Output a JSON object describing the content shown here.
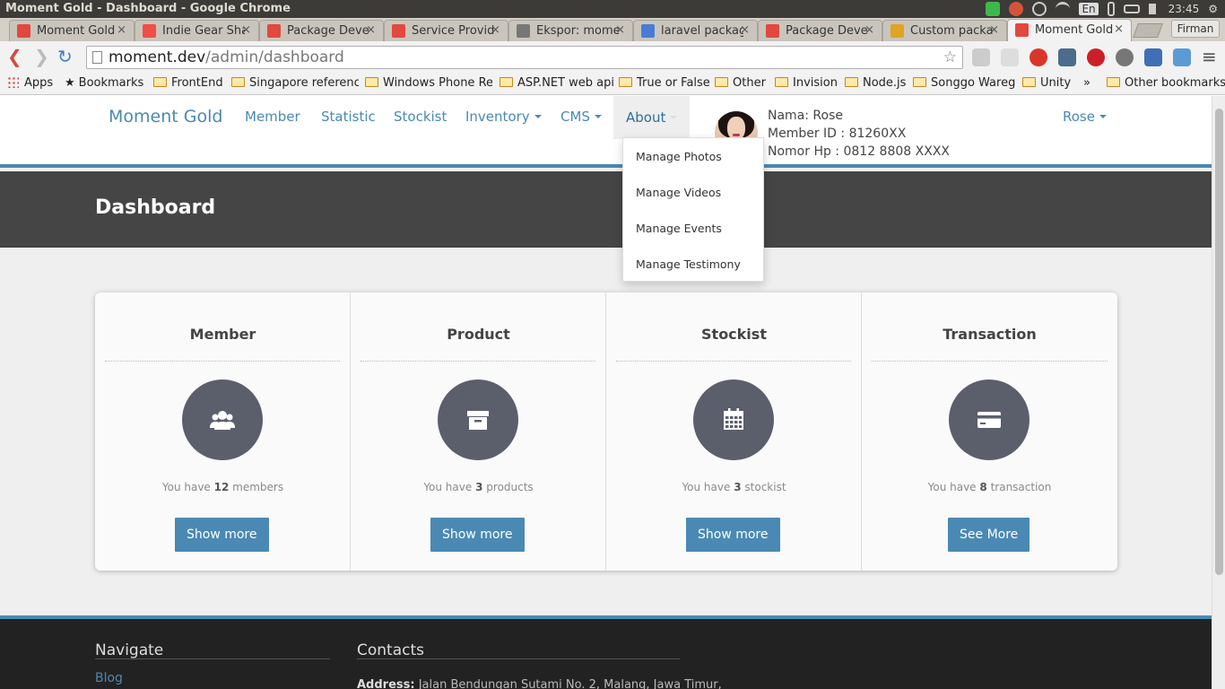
{
  "os": {
    "window_title": "Moment Gold - Dashboard - Google Chrome",
    "keyboard": "En",
    "clock": "23:45"
  },
  "browser": {
    "tabs": [
      {
        "label": "Moment Gold",
        "favicon_color": "#e2483e"
      },
      {
        "label": "Indie Gear Sha",
        "favicon_color": "#f04e47"
      },
      {
        "label": "Package Deve",
        "favicon_color": "#e2483e"
      },
      {
        "label": "Service Provid",
        "favicon_color": "#e2483e"
      },
      {
        "label": "Ekspor: mome",
        "favicon_color": "#777777"
      },
      {
        "label": "laravel packag",
        "favicon_color": "#4a7bd6"
      },
      {
        "label": "Package Deve",
        "favicon_color": "#e2483e"
      },
      {
        "label": "Custom packa",
        "favicon_color": "#e0a422"
      },
      {
        "label": "Moment Gold",
        "favicon_color": "#e2483e"
      }
    ],
    "profile_name": "Firman",
    "url_host": "moment.dev",
    "url_path": "/admin/dashboard",
    "bookmarks": [
      "Apps",
      "Bookmarks",
      "FrontEnd",
      "Singapore reference",
      "Windows Phone Ref",
      "ASP.NET web api",
      "True or False",
      "Other",
      "Invision",
      "Node.js",
      "Songgo Wareg",
      "Unity",
      "»",
      "Other bookmarks"
    ]
  },
  "navbar": {
    "brand": "Moment Gold",
    "items": [
      "Member",
      "Statistic",
      "Stockist",
      "Inventory",
      "CMS",
      "About"
    ],
    "profile": {
      "name_line": "Nama: Rose",
      "member_id_line": "Member ID : 81260XX",
      "phone_line": "Nomor Hp : 0812 8808 XXXX"
    },
    "user_menu": "Rose"
  },
  "about_menu": [
    "Manage Photos",
    "Manage Videos",
    "Manage Events",
    "Manage Testimony"
  ],
  "banner": {
    "title": "Dashboard"
  },
  "cards": [
    {
      "title": "Member",
      "prefix": "You have",
      "count": "12",
      "suffix": "members",
      "button": "Show more",
      "icon": "users-icon"
    },
    {
      "title": "Product",
      "prefix": "You have",
      "count": "3",
      "suffix": "products",
      "button": "Show more",
      "icon": "archive-icon"
    },
    {
      "title": "Stockist",
      "prefix": "You have",
      "count": "3",
      "suffix": "stockist",
      "button": "Show more",
      "icon": "calendar-icon"
    },
    {
      "title": "Transaction",
      "prefix": "You have",
      "count": "8",
      "suffix": "transaction",
      "button": "See More",
      "icon": "credit-card-icon"
    }
  ],
  "footer": {
    "navigate_heading": "Navigate",
    "nav_link": "Blog",
    "contacts_heading": "Contacts",
    "address_label": "Address:",
    "address_text": "Jalan Bendungan Sutami No. 2, Malang, Jawa Timur,"
  },
  "colors": {
    "accent": "#4a89b3",
    "banner": "#454545",
    "icon_circle": "#5b5f6c",
    "footer": "#222222"
  }
}
